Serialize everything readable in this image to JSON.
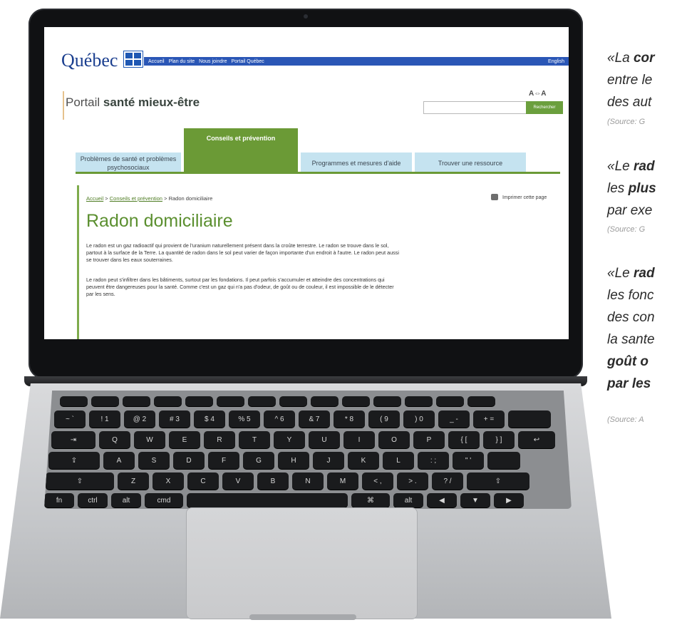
{
  "site": {
    "logo": "Québec",
    "topnav": [
      "Accueil",
      "Plan du site",
      "Nous joindre",
      "Portail Québec"
    ],
    "english": "English",
    "portal_light": "Portail ",
    "portal_bold": "santé mieux-être",
    "text_size_toggle": "A⇔A",
    "search_button": "Rechercher",
    "tabs": [
      "Problèmes de santé et problèmes psychosociaux",
      "Conseils et prévention",
      "Programmes et mesures d'aide",
      "Trouver une ressource"
    ],
    "breadcrumb": [
      "Accueil",
      "Conseils et prévention",
      "Radon domiciliaire"
    ],
    "print_label": "Imprimer cette page",
    "page_title": "Radon domiciliaire",
    "paragraphs": [
      "Le radon est un gaz radioactif qui provient de l'uranium naturellement présent dans la croûte terrestre. Le radon se trouve dans le sol, partout à la surface de la Terre. La quantité de radon dans le sol peut varier de façon importante d'un endroit à l'autre. Le radon peut aussi se trouver dans les eaux souterraines.",
      "Le radon peut s'infiltrer dans les bâtiments, surtout par les fondations. Il peut parfois s'accumuler et atteindre des concentrations qui peuvent être dangereuses pour la santé. Comme c'est un gaz qui n'a pas d'odeur, de goût ou de couleur, il est impossible de le détecter par les sens."
    ]
  },
  "keyboard": {
    "row_numbers": [
      "~ `",
      "! 1",
      "@ 2",
      "# 3",
      "$ 4",
      "% 5",
      "^ 6",
      "& 7",
      "* 8",
      "( 9",
      ") 0",
      "_ -",
      "+ ="
    ],
    "row_qwerty": [
      "Q",
      "W",
      "E",
      "R",
      "T",
      "Y",
      "U",
      "I",
      "O",
      "P",
      "{ [",
      "} ]"
    ],
    "row_home": [
      "A",
      "S",
      "D",
      "F",
      "G",
      "H",
      "J",
      "K",
      "L",
      ": ;",
      "\" '"
    ],
    "row_bottom": [
      "Z",
      "X",
      "C",
      "V",
      "B",
      "N",
      "M",
      "< ,",
      "> .",
      "? /"
    ],
    "mods": {
      "fn": "fn",
      "ctrl": "ctrl",
      "alt": "alt",
      "cmd": "cmd",
      "cmd_symbol": "⌘"
    }
  },
  "quotes": [
    {
      "open": "«La ",
      "bold": "cor",
      "lines": [
        "entre le",
        "des aut"
      ],
      "source": "(Source: G"
    },
    {
      "open": "«Le ",
      "bold": "rad",
      "line2_prefix": "les ",
      "line2_bold": "plus",
      "line3": "par exe",
      "source": "(Source: G"
    },
    {
      "open": "«Le ",
      "bold": "rad",
      "lines": [
        "les fonc",
        "des con",
        "la sante"
      ],
      "bold_lines": [
        "goût o",
        "par les"
      ],
      "source": "(Source: A"
    }
  ]
}
